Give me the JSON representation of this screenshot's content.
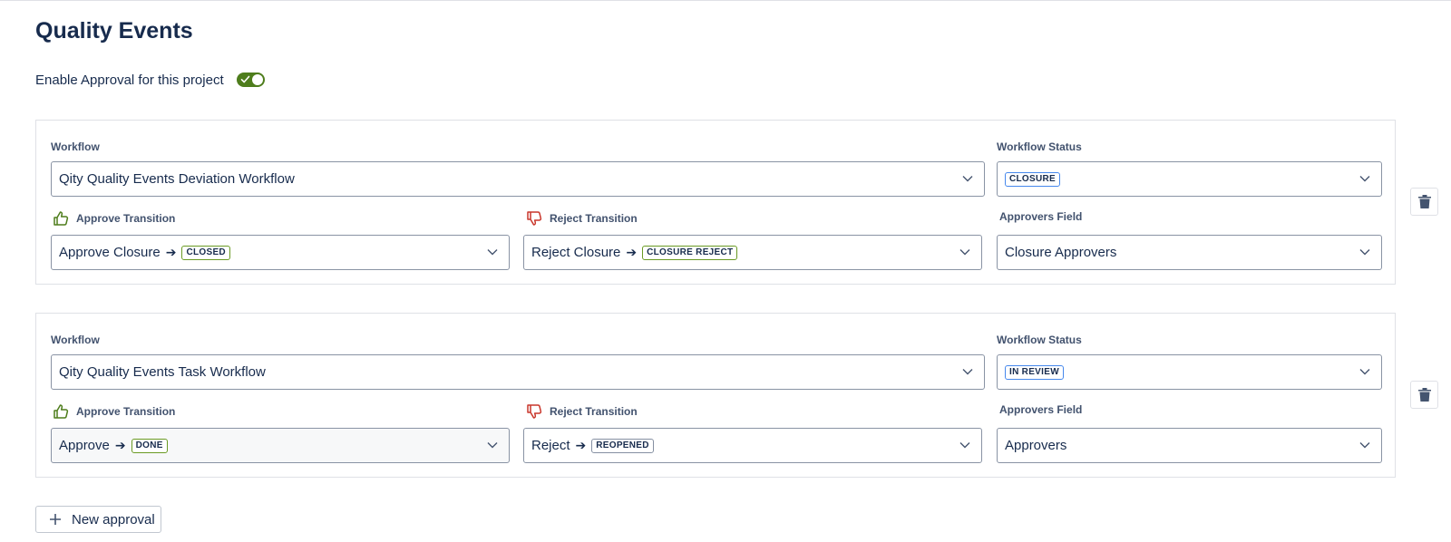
{
  "page": {
    "title": "Quality Events",
    "toggle_label": "Enable Approval for this project",
    "toggle_on": true,
    "accent_color": "#4e7d1c"
  },
  "labels": {
    "workflow": "Workflow",
    "workflow_status": "Workflow Status",
    "approve_transition": "Approve Transition",
    "reject_transition": "Reject Transition",
    "approvers_field": "Approvers Field"
  },
  "approvals": [
    {
      "workflow": "Qity Quality Events Deviation Workflow",
      "status": "CLOSURE",
      "approve_name": "Approve Closure",
      "approve_target": "CLOSED",
      "reject_name": "Reject Closure",
      "reject_target": "CLOSURE REJECT",
      "approvers_field": "Closure Approvers"
    },
    {
      "workflow": "Qity Quality Events Task Workflow",
      "status": "IN REVIEW",
      "approve_name": "Approve",
      "approve_target": "DONE",
      "reject_name": "Reject",
      "reject_target": "REOPENED",
      "approvers_field": "Approvers"
    }
  ],
  "icons": {
    "approve": "thumbs-up-icon",
    "reject": "thumbs-down-icon",
    "delete": "trash-icon",
    "add": "plus-icon",
    "dropdown": "chevron-down-icon"
  },
  "buttons": {
    "new_approval": "New approval"
  }
}
